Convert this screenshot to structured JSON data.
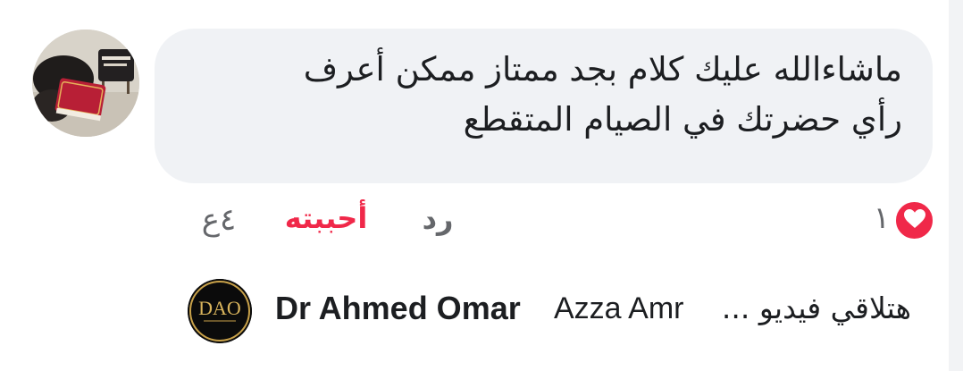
{
  "comment": {
    "text_line_1": "ماشاءالله عليك كلام بجد ممتاز ممكن أعرف",
    "text_line_2": "رأي حضرتك في الصيام المتقطع",
    "reaction_count": "١",
    "reaction_icon": "heart-icon",
    "reply_label": "رد",
    "liked_label": "أحببته",
    "timestamp": "٤ع"
  },
  "reply_preview": {
    "author": "Dr Ahmed Omar",
    "mention": "Azza Amr",
    "preview_text": "هتلاقي فيديو ...",
    "avatar_text": "DAO"
  },
  "colors": {
    "bubble_bg": "#f0f2f5",
    "love_red": "#f02849",
    "muted_text": "#65676b"
  }
}
